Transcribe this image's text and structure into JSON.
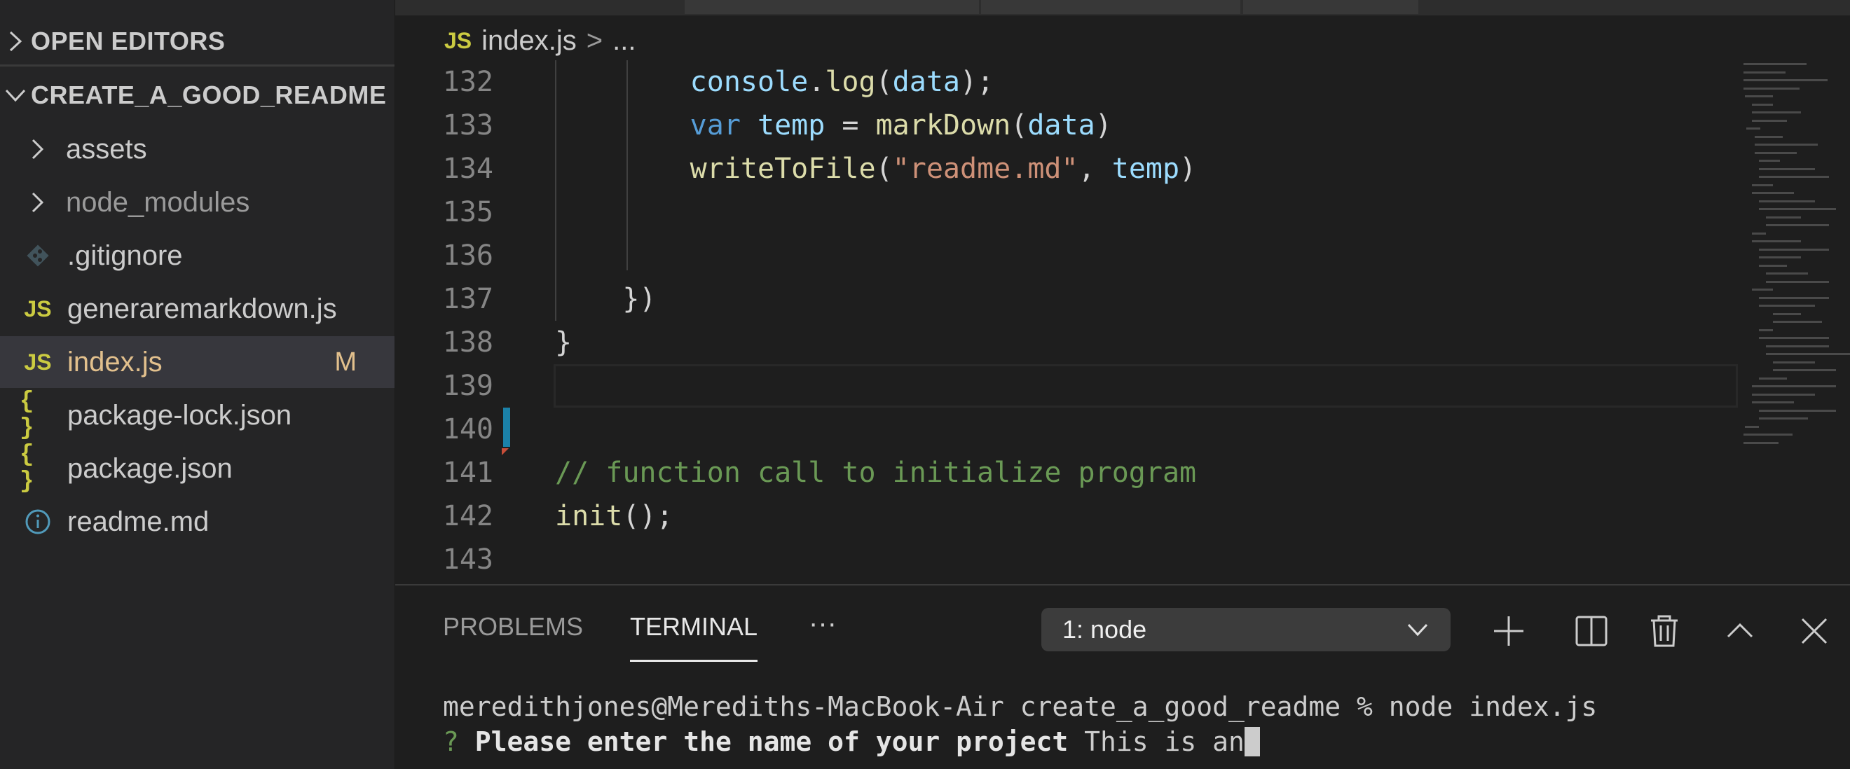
{
  "sidebar": {
    "open_editors": "OPEN EDITORS",
    "project": "CREATE_A_GOOD_README",
    "items": [
      {
        "name": "assets",
        "kind": "folder"
      },
      {
        "name": "node_modules",
        "kind": "folder"
      },
      {
        "name": ".gitignore",
        "kind": "git"
      },
      {
        "name": "generaremarkdown.js",
        "kind": "js"
      },
      {
        "name": "index.js",
        "kind": "js",
        "badge": "M",
        "selected": true
      },
      {
        "name": "package-lock.json",
        "kind": "json"
      },
      {
        "name": "package.json",
        "kind": "json"
      },
      {
        "name": "readme.md",
        "kind": "info"
      }
    ],
    "icons": {
      "js": "JS",
      "json": "{ }"
    }
  },
  "editor": {
    "breadcrumb": {
      "lang": "JS",
      "file": "index.js",
      "sep": ">",
      "more": "..."
    },
    "lines": [
      {
        "n": "132",
        "parts": [
          [
            "",
            "        "
          ],
          [
            "var",
            "console"
          ],
          [
            "",
            "."
          ],
          [
            "fn",
            "log"
          ],
          [
            "",
            "("
          ],
          [
            "var",
            "data"
          ],
          [
            "",
            ");"
          ]
        ]
      },
      {
        "n": "133",
        "parts": [
          [
            "",
            "        "
          ],
          [
            "kw",
            "var"
          ],
          [
            "",
            " "
          ],
          [
            "var",
            "temp"
          ],
          [
            "",
            " = "
          ],
          [
            "fn",
            "markDown"
          ],
          [
            "",
            "("
          ],
          [
            "var",
            "data"
          ],
          [
            "",
            ")"
          ]
        ]
      },
      {
        "n": "134",
        "parts": [
          [
            "",
            "        "
          ],
          [
            "fn",
            "writeToFile"
          ],
          [
            "",
            "("
          ],
          [
            "str",
            "\"readme.md\""
          ],
          [
            "",
            ", "
          ],
          [
            "var",
            "temp"
          ],
          [
            "",
            ")"
          ]
        ]
      },
      {
        "n": "135",
        "parts": []
      },
      {
        "n": "136",
        "parts": []
      },
      {
        "n": "137",
        "parts": [
          [
            "",
            "    })"
          ]
        ]
      },
      {
        "n": "138",
        "parts": [
          [
            "",
            "}"
          ]
        ]
      },
      {
        "n": "139",
        "parts": [],
        "current": true
      },
      {
        "n": "140",
        "parts": []
      },
      {
        "n": "141",
        "parts": [
          [
            "cm",
            "// function call to initialize program"
          ]
        ]
      },
      {
        "n": "142",
        "parts": [
          [
            "fn",
            "init"
          ],
          [
            "",
            "();"
          ]
        ]
      },
      {
        "n": "143",
        "parts": []
      }
    ]
  },
  "panel": {
    "tabs": [
      "PROBLEMS",
      "TERMINAL"
    ],
    "active_tab": "TERMINAL",
    "more": "···",
    "terminal_select": "1: node",
    "terminal": {
      "line1": "meredithjones@Merediths-MacBook-Air create_a_good_readme % node index.js",
      "prompt_mark": "?",
      "prompt_question": "Please enter the name of your project",
      "prompt_answer": "This is an"
    }
  }
}
